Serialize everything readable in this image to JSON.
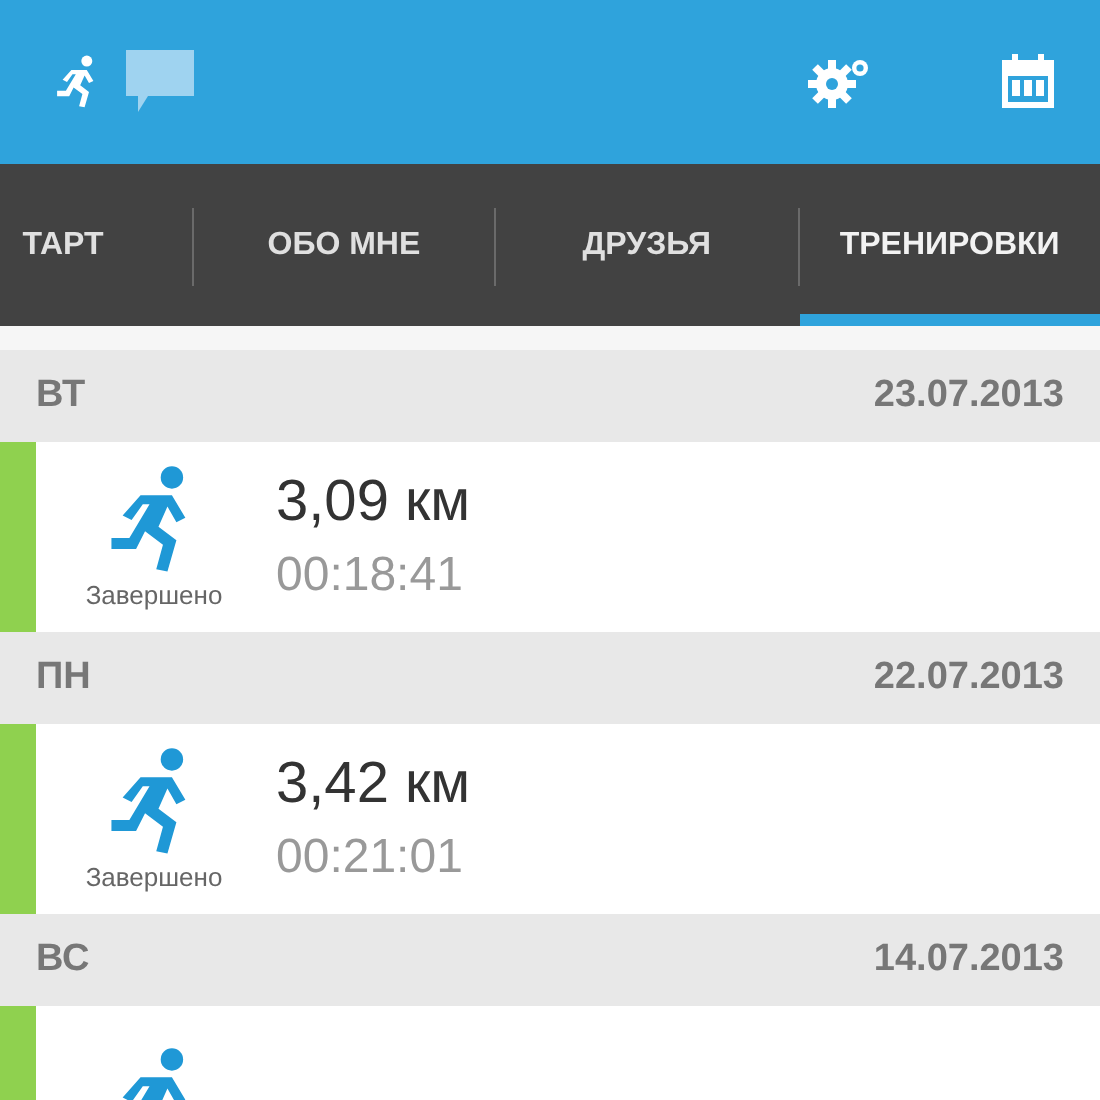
{
  "tabs": [
    {
      "label": "ТАРТ",
      "selected": false
    },
    {
      "label": "ОБО МНЕ",
      "selected": false
    },
    {
      "label": "ДРУЗЬЯ",
      "selected": false
    },
    {
      "label": "ТРЕНИРОВКИ",
      "selected": true
    }
  ],
  "days": [
    {
      "weekday": "ВТ",
      "date": "23.07.2013",
      "workouts": [
        {
          "completed": true,
          "status": "Завершено",
          "distance": "3,09 км",
          "duration": "00:18:41"
        }
      ]
    },
    {
      "weekday": "ПН",
      "date": "22.07.2013",
      "workouts": [
        {
          "completed": true,
          "status": "Завершено",
          "distance": "3,42 км",
          "duration": "00:21:01"
        }
      ]
    },
    {
      "weekday": "ВС",
      "date": "14.07.2013",
      "workouts": [
        {
          "completed": true
        }
      ]
    }
  ]
}
